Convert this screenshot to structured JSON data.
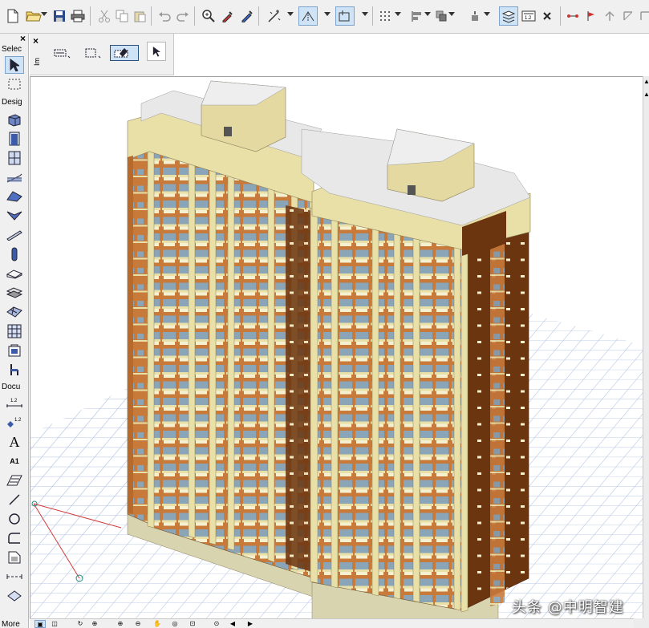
{
  "toolbar": {
    "buttons": [
      "new-file",
      "open-file",
      "save",
      "print",
      "cut",
      "copy",
      "paste",
      "undo",
      "redo",
      "find-select",
      "pick-up",
      "inject",
      "magic-wand",
      "gravity",
      "trace-reference",
      "grid-snap",
      "align",
      "distribute",
      "elevation",
      "layer-combination",
      "dimension-standard",
      "delete",
      "sections",
      "elevation-markers",
      "interior-elevations",
      "worksheets"
    ]
  },
  "toolbox": {
    "close_label": "×",
    "select_header": "Selec",
    "design_header": "Desig",
    "document_header": "Docu",
    "more_header": "More",
    "text_tool_glyph": "A",
    "label_tool_glyph": "A1",
    "dimension_glyph": "1.2"
  },
  "infobox": {
    "close_label": "×",
    "vertical_label": "Im"
  },
  "viewport": {
    "description": "3D axonometric view of two high-rise residential towers on a grid"
  },
  "watermark": {
    "text": "头条 @中明智建"
  },
  "colors": {
    "facade_orange": "#c87a3a",
    "facade_dark": "#6b3510",
    "trim_cream": "#e9e0a8",
    "roof_light": "#e8e8e8",
    "grid_blue": "#b9c9e6",
    "window_blue": "#8aa4b8",
    "toolbar_bg": "#f0f0f0",
    "highlight": "#cfe3f7"
  }
}
